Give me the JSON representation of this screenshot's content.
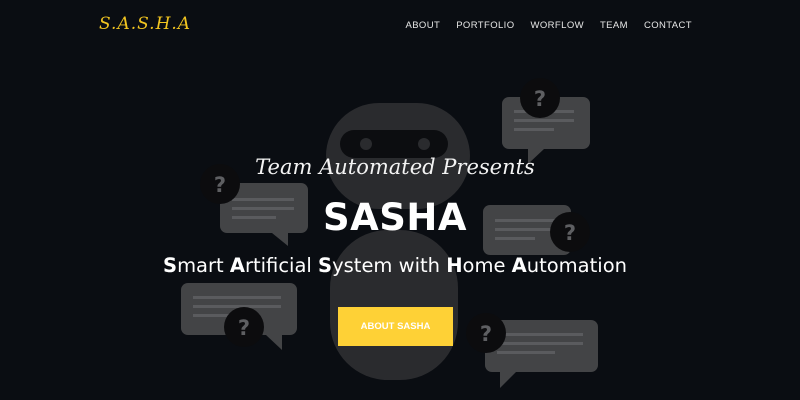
{
  "brand": {
    "logo": "S.A.S.H.A",
    "accent": "#f2c520",
    "button_color": "#fed136"
  },
  "nav": {
    "items": [
      {
        "label": "ABOUT"
      },
      {
        "label": "PORTFOLIO"
      },
      {
        "label": "WORFLOW"
      },
      {
        "label": "TEAM"
      },
      {
        "label": "CONTACT"
      }
    ]
  },
  "hero": {
    "intro": "Team Automated Presents",
    "title": "SASHA",
    "tagline": [
      {
        "initial": "S",
        "rest": "mart "
      },
      {
        "initial": "A",
        "rest": "rtificial "
      },
      {
        "initial": "S",
        "rest": "ystem with "
      },
      {
        "initial": "H",
        "rest": "ome "
      },
      {
        "initial": "A",
        "rest": "utomation"
      }
    ],
    "cta_label": "ABOUT SASHA"
  },
  "background": {
    "icons": [
      "robot-illustration",
      "speech-bubble-icon",
      "question-mark-icon"
    ],
    "question_mark": "?"
  }
}
